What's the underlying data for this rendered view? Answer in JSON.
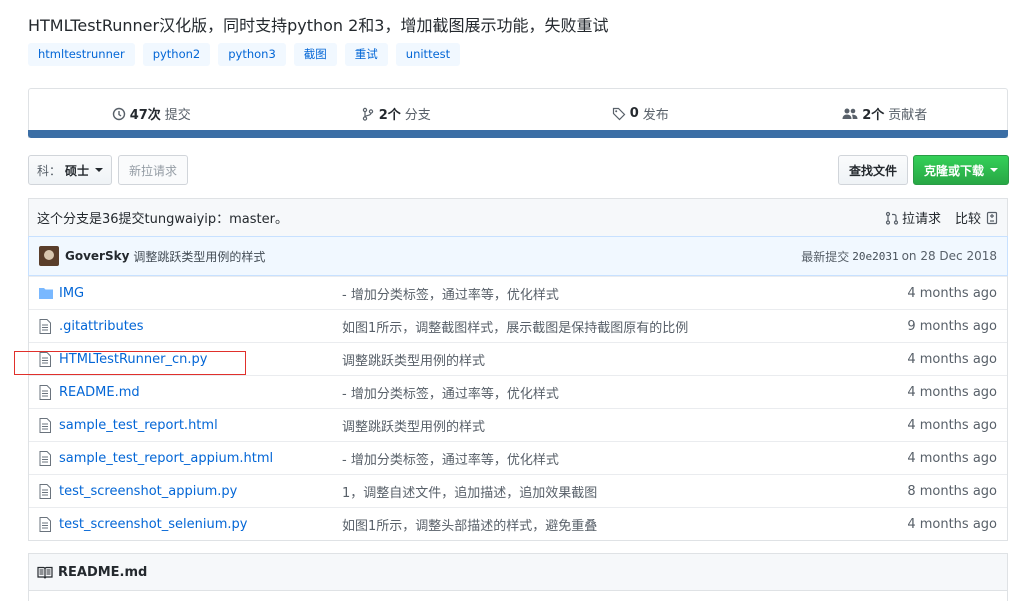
{
  "repo": {
    "description": "HTMLTestRunner汉化版，同时支持python 2和3，增加截图展示功能，失败重试",
    "topics": [
      "htmltestrunner",
      "python2",
      "python3",
      "截图",
      "重试",
      "unittest"
    ]
  },
  "stats": {
    "commits_count": "47次",
    "commits_label": "提交",
    "branches_count": "2个",
    "branches_label": "分支",
    "releases_count": "0",
    "releases_label": "发布",
    "contributors_count": "2个",
    "contributors_label": "贡献者",
    "bar_color": "#3b6ea5"
  },
  "toolbar": {
    "branch_prefix": "科：",
    "branch_name": "硕士",
    "new_pr": "新拉请求",
    "find_file": "查找文件",
    "clone": "克隆或下载"
  },
  "branch_info": {
    "text": "这个分支是36提交tungwaiyip：master。",
    "pull_request": "拉请求",
    "compare": "比较"
  },
  "latest_commit": {
    "author": "GoverSky",
    "message": "调整跳跃类型用例的样式",
    "label": "最新提交",
    "sha": "20e2031",
    "date": "on 28 Dec 2018"
  },
  "files": [
    {
      "name": "IMG",
      "type": "dir",
      "message": "- 增加分类标签，通过率等，优化样式",
      "age": "4 months ago"
    },
    {
      "name": ".gitattributes",
      "type": "file",
      "message": "如图1所示，调整截图样式，展示截图是保持截图原有的比例",
      "age": "9 months ago"
    },
    {
      "name": "HTMLTestRunner_cn.py",
      "type": "file",
      "message": "调整跳跃类型用例的样式",
      "age": "4 months ago"
    },
    {
      "name": "README.md",
      "type": "file",
      "message": "- 增加分类标签，通过率等，优化样式",
      "age": "4 months ago"
    },
    {
      "name": "sample_test_report.html",
      "type": "file",
      "message": "调整跳跃类型用例的样式",
      "age": "4 months ago"
    },
    {
      "name": "sample_test_report_appium.html",
      "type": "file",
      "message": "- 增加分类标签，通过率等，优化样式",
      "age": "4 months ago"
    },
    {
      "name": "test_screenshot_appium.py",
      "type": "file",
      "message": "1，调整自述文件，追加描述，追加效果截图",
      "age": "8 months ago"
    },
    {
      "name": "test_screenshot_selenium.py",
      "type": "file",
      "message": "如图1所示，调整头部描述的样式，避免重叠",
      "age": "4 months ago"
    }
  ],
  "readme": {
    "title": "README.md"
  },
  "colors": {
    "link": "#0366d6",
    "highlight_box": "#e0302b",
    "clone_button": "#28a745"
  }
}
